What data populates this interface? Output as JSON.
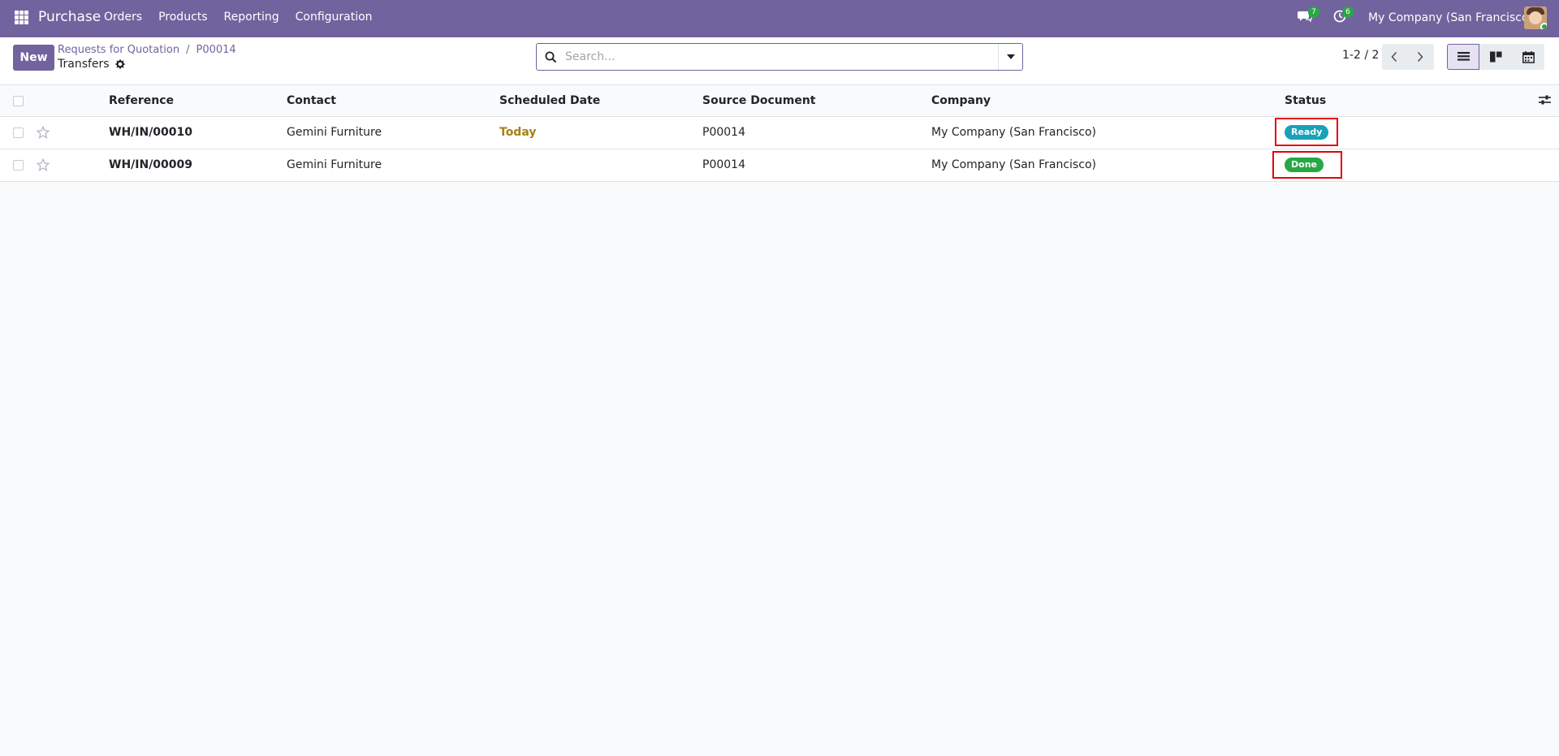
{
  "navbar": {
    "brand": "Purchase",
    "menu": [
      "Orders",
      "Products",
      "Reporting",
      "Configuration"
    ],
    "messages_count": "7",
    "activities_count": "6",
    "company": "My Company (San Francisco)",
    "color": "#71639e"
  },
  "control_panel": {
    "new_label": "New",
    "breadcrumb": [
      "Requests for Quotation",
      "P00014"
    ],
    "title": "Transfers",
    "search_placeholder": "Search...",
    "search_value": "",
    "pager": "1-2 / 2"
  },
  "table": {
    "columns": [
      "Reference",
      "Contact",
      "Scheduled Date",
      "Source Document",
      "Company",
      "Status"
    ],
    "rows": [
      {
        "reference": "WH/IN/00010",
        "contact": "Gemini Furniture",
        "scheduled_date": "Today",
        "source_document": "P00014",
        "company": "My Company (San Francisco)",
        "status": "Ready",
        "status_color": "#17a2b8"
      },
      {
        "reference": "WH/IN/00009",
        "contact": "Gemini Furniture",
        "scheduled_date": "",
        "source_document": "P00014",
        "company": "My Company (San Francisco)",
        "status": "Done",
        "status_color": "#28a745"
      }
    ]
  },
  "icons": [
    "apps-grid-icon",
    "chat-icon",
    "clock-activity-icon",
    "gear-icon",
    "search-icon",
    "caret-down-icon",
    "chevron-left-icon",
    "chevron-right-icon",
    "list-view-icon",
    "kanban-view-icon",
    "calendar-view-icon",
    "star-icon",
    "optional-columns-icon"
  ],
  "highlight_color": "#e8000b"
}
